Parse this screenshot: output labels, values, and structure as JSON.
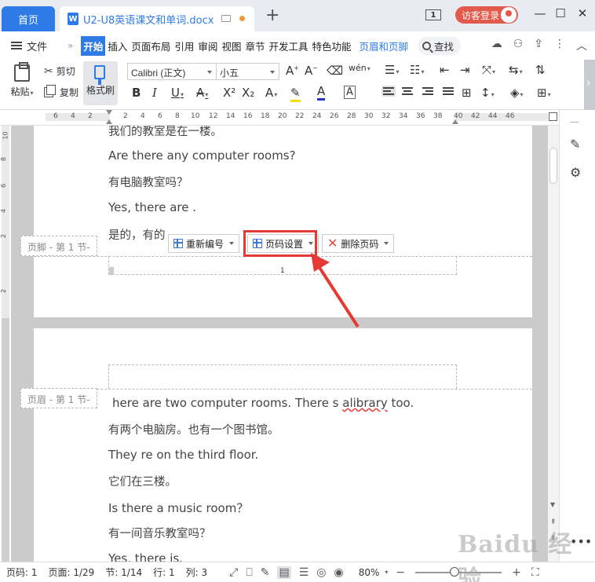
{
  "titlebar": {
    "home_tab": "首页",
    "doc_icon": "W",
    "doc_tab": "U2-U8英语课文和单词.docx",
    "page_indicator": "1",
    "login_label": "访客登录",
    "icons": [
      "monitor-icon",
      "unsaved-dot-icon",
      "new-tab-plus-icon",
      "minimize-icon",
      "restore-icon",
      "close-icon"
    ]
  },
  "menubar": {
    "file": "文件",
    "more": "»",
    "items": [
      "开始",
      "插入",
      "页面布局",
      "引用",
      "审阅",
      "视图",
      "章节",
      "开发工具",
      "特色功能"
    ],
    "active": "开始",
    "header_footer": "页眉和页脚",
    "search": "查找"
  },
  "ribbon": {
    "paste": "粘贴",
    "cut": "剪切",
    "copy": "复制",
    "format_painter": "格式刷",
    "font_name": "Calibri (正文)",
    "font_size": "小五",
    "bold": "B",
    "italic": "I",
    "underline": "U",
    "pinyin": "wén"
  },
  "ruler": {
    "numbers": [
      "6",
      "4",
      "2",
      "2",
      "4",
      "6",
      "8",
      "10",
      "12",
      "14",
      "16",
      "18",
      "20",
      "22",
      "24",
      "26",
      "28",
      "30",
      "32",
      "34",
      "36",
      "38",
      "40",
      "42",
      "44",
      "46"
    ],
    "vertical_numbers": [
      "10",
      "8",
      "6",
      "4",
      "2",
      "2"
    ]
  },
  "document": {
    "page1_lines": [
      "我们的教室是在一楼。",
      "Are there any computer rooms?",
      "有电脑教室吗？",
      "Yes, there are .",
      "是的，有的"
    ],
    "footer_label": "页脚 - 第 1 节-",
    "footer_page_number": "1",
    "header_label": "页眉 - 第 1 节-",
    "page2_line1_pre": "here are two computer rooms. There s ",
    "page2_line1_err": "alibrary",
    "page2_line1_post": " too.",
    "page2_lines": [
      "有两个电脑房。也有一个图书馆。",
      "They re on the third floor.",
      "它们在三楼。",
      "Is there a music room？",
      "有一间音乐教室吗？",
      "Yes, there is."
    ],
    "float_buttons": {
      "renumber": "重新编号",
      "page_setup": "页码设置",
      "delete_page_num": "删除页码"
    }
  },
  "statusbar": {
    "page_code": "页码: 1",
    "page": "页面: 1/29",
    "section": "节: 1/14",
    "row": "行: 1",
    "col": "列: 3",
    "zoom": "80%",
    "zoom_level": 0.45
  },
  "watermark": "Baidu 经验",
  "colors": {
    "accent": "#2e7be6",
    "highlight": "#e53a34",
    "login": "#e25a4b"
  }
}
